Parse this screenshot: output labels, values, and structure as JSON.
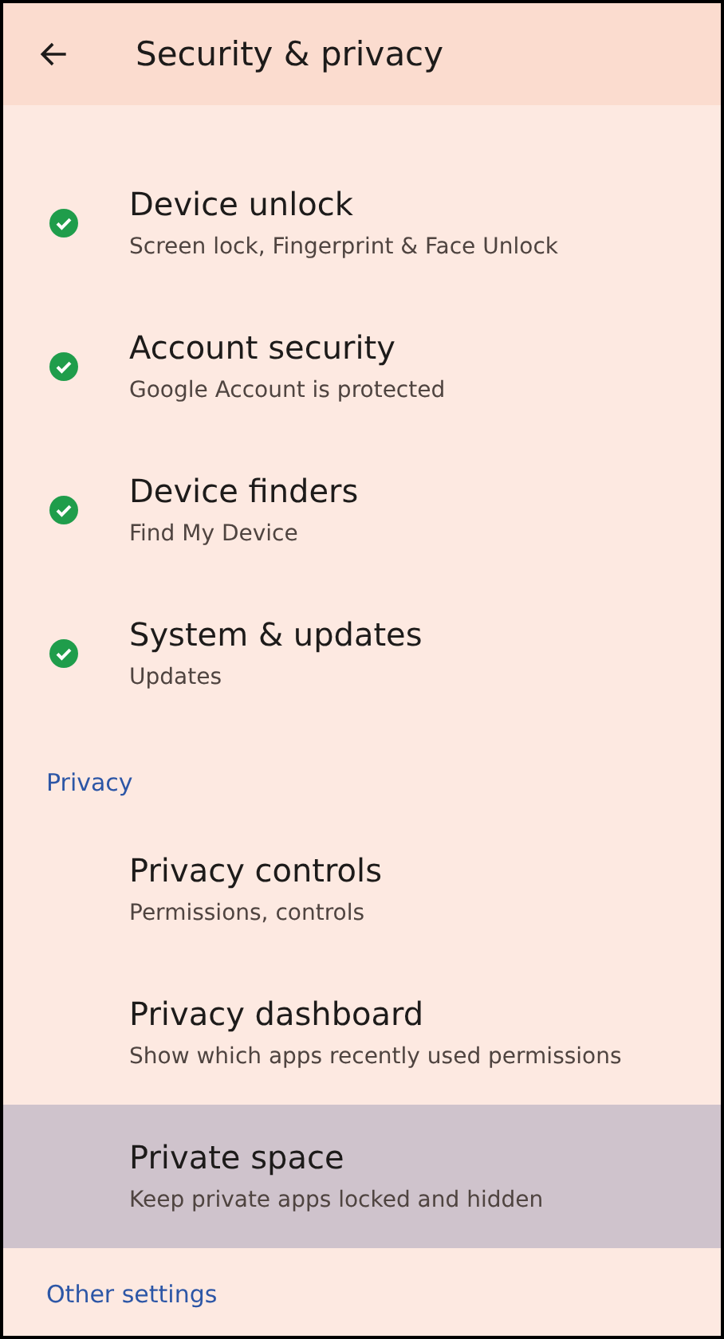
{
  "header": {
    "title": "Security & privacy"
  },
  "status_items": [
    {
      "title": "Device unlock",
      "summary": "Screen lock, Fingerprint & Face Unlock",
      "kind": "check",
      "selected": false
    },
    {
      "title": "Account security",
      "summary": "Google Account is protected",
      "kind": "check",
      "selected": false
    },
    {
      "title": "Device finders",
      "summary": "Find My Device",
      "kind": "check",
      "selected": false
    },
    {
      "title": "System & updates",
      "summary": "Updates",
      "kind": "check",
      "selected": false
    }
  ],
  "sections": [
    {
      "heading": "Privacy",
      "items": [
        {
          "title": "Privacy controls",
          "summary": "Permissions, controls",
          "selected": false
        },
        {
          "title": "Privacy dashboard",
          "summary": "Show which apps recently used permissions",
          "selected": false
        },
        {
          "title": "Private space",
          "summary": "Keep private apps locked and hidden",
          "selected": true
        }
      ]
    },
    {
      "heading": "Other settings"
    }
  ]
}
